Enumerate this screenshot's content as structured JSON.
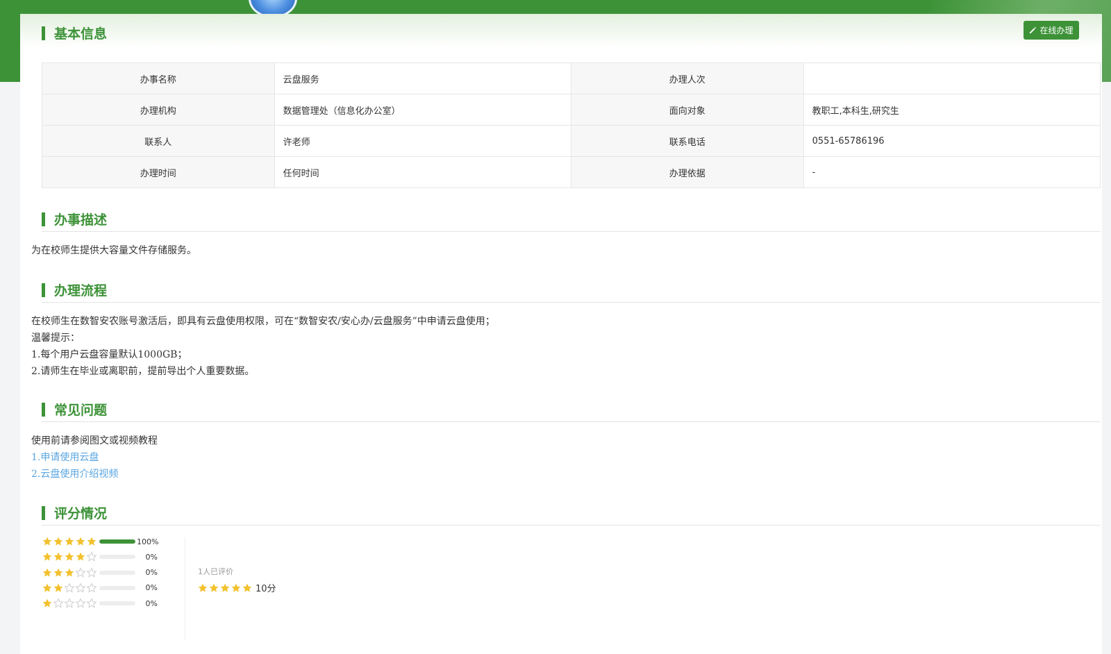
{
  "header": {
    "online_button_label": "在线办理"
  },
  "sections": {
    "basic_info": "基本信息",
    "description": "办事描述",
    "process": "办理流程",
    "faq": "常见问题",
    "rating": "评分情况"
  },
  "info_table": [
    {
      "l1": "办事名称",
      "v1": "云盘服务",
      "l2": "办理人次",
      "v2": ""
    },
    {
      "l1": "办理机构",
      "v1": "数据管理处（信息化办公室）",
      "l2": "面向对象",
      "v2": "教职工,本科生,研究生"
    },
    {
      "l1": "联系人",
      "v1": "许老师",
      "l2": "联系电话",
      "v2": "0551-65786196"
    },
    {
      "l1": "办理时间",
      "v1": "任何时间",
      "l2": "办理依据",
      "v2": "-"
    }
  ],
  "description_text": "为在校师生提供大容量文件存储服务。",
  "process_lines": [
    "在校师生在数智安农账号激活后，即具有云盘使用权限，可在“数智安农/安心办/云盘服务”中申请云盘使用；",
    "温馨提示：",
    "1.每个用户云盘容量默认1000GB；",
    "2.请师生在毕业或离职前，提前导出个人重要数据。"
  ],
  "faq": {
    "intro": "使用前请参阅图文或视频教程",
    "links": [
      "1.申请使用云盘",
      "2.云盘使用介绍视频"
    ]
  },
  "rating": {
    "rows": [
      {
        "stars": 5,
        "percent": "100%",
        "fraction": 1.0
      },
      {
        "stars": 4,
        "percent": "0%",
        "fraction": 0
      },
      {
        "stars": 3,
        "percent": "0%",
        "fraction": 0
      },
      {
        "stars": 2,
        "percent": "0%",
        "fraction": 0
      },
      {
        "stars": 1,
        "percent": "0%",
        "fraction": 0
      }
    ],
    "rated_count_text": "1人已评价",
    "score_text": "10分",
    "score_stars": 5,
    "star_color": "#f2c12e",
    "empty_star_color": "#cfcfcf"
  },
  "colors": {
    "accent": "#3d9238",
    "link": "#5aa6e0"
  }
}
